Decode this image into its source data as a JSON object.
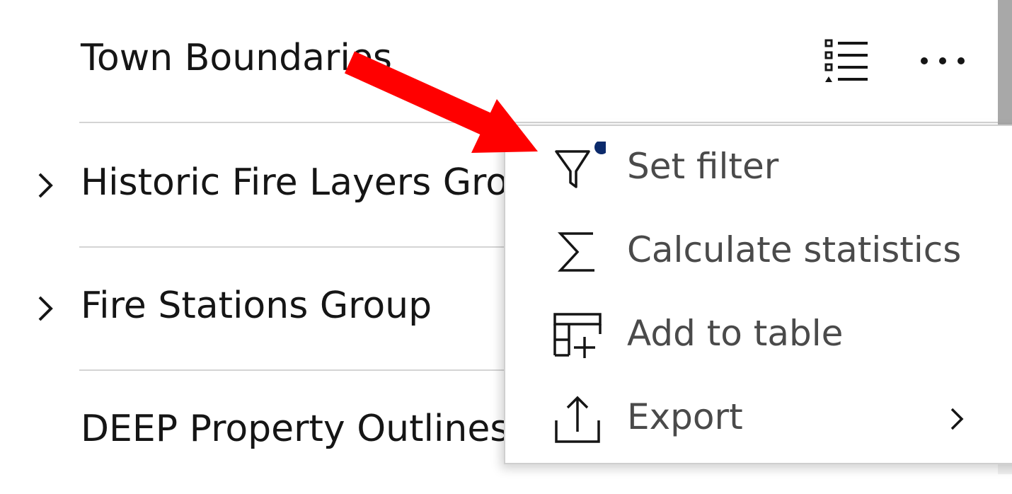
{
  "layers": [
    {
      "label": "Town Boundaries",
      "expandable": false
    },
    {
      "label": "Historic Fire Layers Group",
      "expandable": true
    },
    {
      "label": "Fire Stations Group",
      "expandable": true
    },
    {
      "label": "DEEP Property Outlines",
      "expandable": false
    }
  ],
  "layer_actions": {
    "legend_icon": "legend-list-icon",
    "more_icon": "ellipsis-icon"
  },
  "context_menu": {
    "items": [
      {
        "label": "Set filter",
        "icon": "filter-icon",
        "indicator": true
      },
      {
        "label": "Calculate statistics",
        "icon": "sigma-icon"
      },
      {
        "label": "Add to table",
        "icon": "table-add-icon"
      },
      {
        "label": "Export",
        "icon": "export-icon",
        "has_submenu": true
      }
    ]
  },
  "colors": {
    "text": "#151515",
    "menu_text": "#4a4a4a",
    "divider": "#d4d4d4",
    "filter_indicator": "#0b2a6b",
    "annotation_arrow": "#ff0000"
  }
}
